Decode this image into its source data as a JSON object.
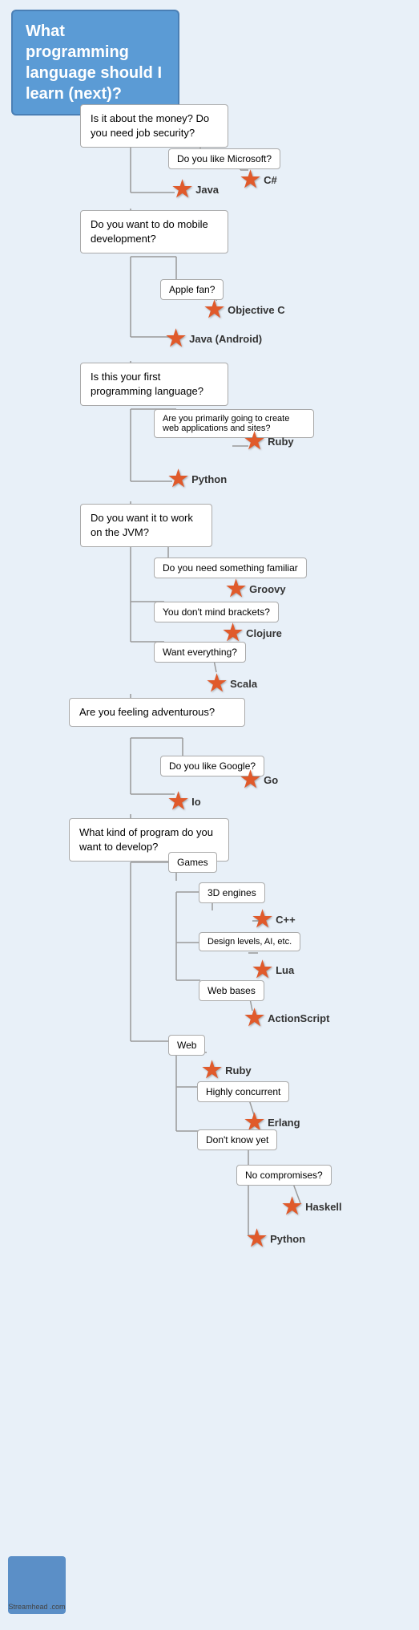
{
  "title": "What programming language should I learn (next)?",
  "questions": [
    {
      "id": "q1",
      "text": "Is it about the money? Do you need job security?"
    },
    {
      "id": "q2",
      "text": "Do you want to do mobile development?"
    },
    {
      "id": "q3",
      "text": "Is this your first programming language?"
    },
    {
      "id": "q4",
      "text": "Do you want it to work on the JVM?"
    },
    {
      "id": "q5",
      "text": "Are you feeling adventurous?"
    },
    {
      "id": "q6",
      "text": "What kind of program do you want to develop?"
    }
  ],
  "subquestions": [
    "Do you like Microsoft?",
    "Apple fan?",
    "Are you primarily going to create web applications and sites?",
    "Do you need something familiar",
    "You don't mind brackets?",
    "Want everything?",
    "Do you like Google?",
    "Games",
    "3D engines",
    "Design levels, AI, etc.",
    "Web bases",
    "Web",
    "Highly concurrent",
    "Don't know yet",
    "No compromises?"
  ],
  "languages": [
    "C#",
    "Java",
    "Objective C",
    "Java (Android)",
    "Ruby",
    "Python",
    "Groovy",
    "Clojure",
    "Scala",
    "Go",
    "Io",
    "C++",
    "Lua",
    "ActionScript",
    "Ruby",
    "Erlang",
    "Haskell",
    "Python"
  ],
  "streamhead": "Streamhead\n.com"
}
